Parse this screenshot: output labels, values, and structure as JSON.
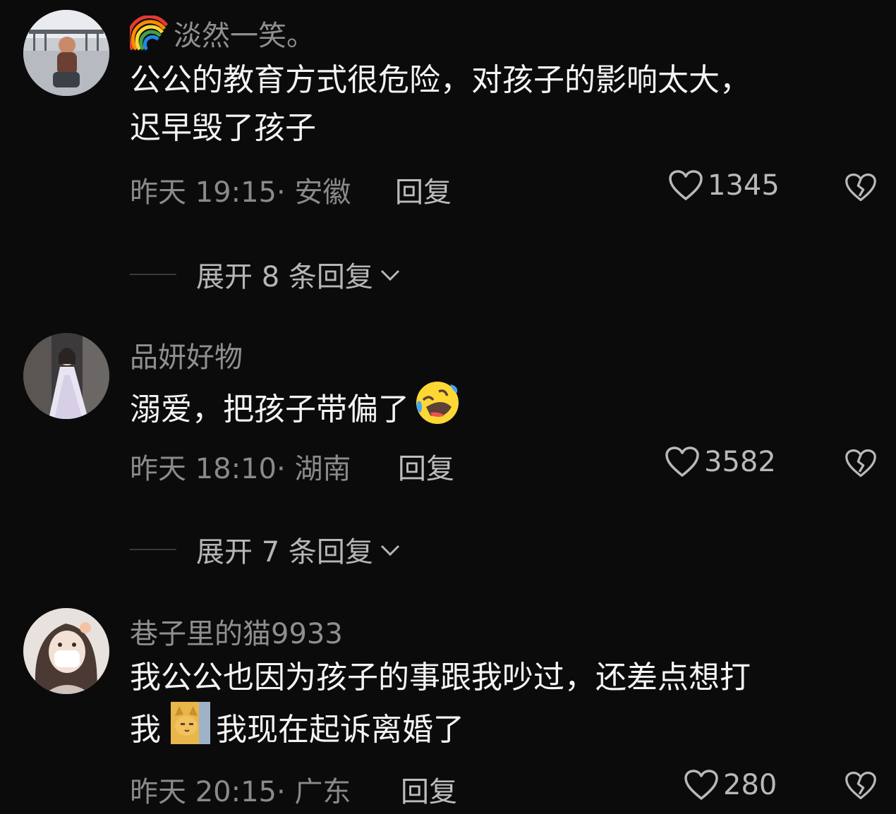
{
  "comments": [
    {
      "username": "淡然一笑。",
      "username_prefix_icon": "rainbow-emoji",
      "text_line1": "公公的教育方式很危险，对孩子的影响太大，",
      "text_line2": "迟早毁了孩子",
      "time": "昨天 19:15",
      "location": "安徽",
      "reply_label": "回复",
      "likes": "1345",
      "expand_label": "展开 8 条回复"
    },
    {
      "username": "品妍好物",
      "text": "溺爱，把孩子带偏了",
      "text_suffix_icon": "rolling-laughing-emoji",
      "time": "昨天 18:10",
      "location": "湖南",
      "reply_label": "回复",
      "likes": "3582",
      "expand_label": "展开 7 条回复"
    },
    {
      "username": "巷子里的猫9933",
      "text_line1": "我公公也因为孩子的事跟我吵过，还差点想打",
      "text_line2_a": "我",
      "text_line2_icon": "cat-sticker-emoji",
      "text_line2_b": "我现在起诉离婚了",
      "time": "昨天 20:15",
      "location": "广东",
      "reply_label": "回复",
      "likes": "280"
    }
  ],
  "colors": {
    "background": "#0b0b0c",
    "primary_text": "#f4f4f4",
    "secondary_text": "#8a8a8a"
  }
}
